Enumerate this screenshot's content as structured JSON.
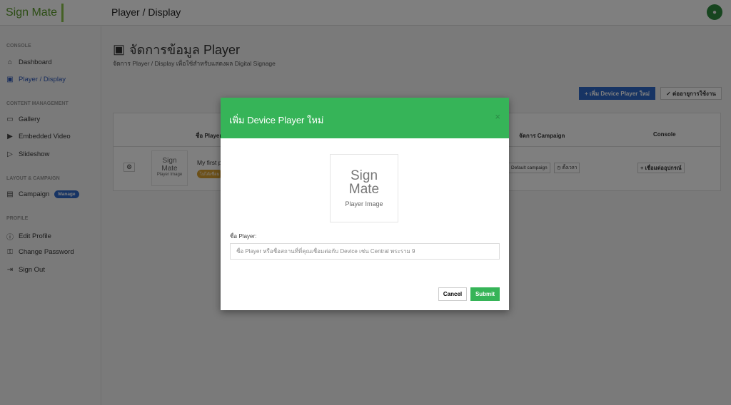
{
  "header": {
    "logo": "Sign Mate",
    "title": "Player / Display"
  },
  "sidebar": {
    "sections": [
      "CONSOLE",
      "CONTENT MANAGEMENT",
      "LAYOUT & CAMPAIGN",
      "PROFILE"
    ],
    "items": [
      {
        "label": "Dashboard",
        "icon": "home-icon"
      },
      {
        "label": "Player / Display",
        "icon": "tv-play-icon",
        "active": true
      },
      {
        "label": "Gallery",
        "icon": "gallery-icon"
      },
      {
        "label": "Embedded Video",
        "icon": "video-library-icon"
      },
      {
        "label": "Slideshow",
        "icon": "slideshow-icon"
      },
      {
        "label": "Campaign",
        "icon": "monitor-icon",
        "badge": "Manage"
      },
      {
        "label": "Edit Profile",
        "icon": "info-icon"
      },
      {
        "label": "Change Password",
        "icon": "key-icon"
      },
      {
        "label": "Sign Out",
        "icon": "sign-out-icon"
      }
    ]
  },
  "page": {
    "title": "จัดการข้อมูล Player",
    "subtitle": "จัดการ Player / Display เพื่อใช้สำหรับแสดงผล Digital Signage",
    "add_button": "+ เพิ่ม Device Player ใหม่",
    "renew_button": "✓ ต่ออายุการใช้งาน"
  },
  "table": {
    "headers": [
      "ชื่อ Player",
      "จัดการ Campaign",
      "Console"
    ],
    "row": {
      "name": "My first p",
      "status": "ไม่ได้เชื่อม",
      "image_caption": "Player Image",
      "campaign": "Default campaign",
      "schedule": "◷ ตั้งเวลา",
      "connect": "+ เชื่อมต่ออุปกรณ์"
    }
  },
  "modal": {
    "title": "เพิ่ม Device Player ใหม่",
    "close": "×",
    "image_logo": "Sign Mate",
    "image_caption": "Player Image",
    "label": "ชื่อ Player:",
    "placeholder": "ชื่อ Player หรือชื่อสถานที่ที่คุณเชื่อมต่อกับ Device เช่น Central พระราม 9",
    "value": "",
    "cancel": "Cancel",
    "submit": "Submit"
  },
  "colors": {
    "primary": "#2e68c8",
    "success": "#36b458",
    "warning": "#d9a030"
  }
}
